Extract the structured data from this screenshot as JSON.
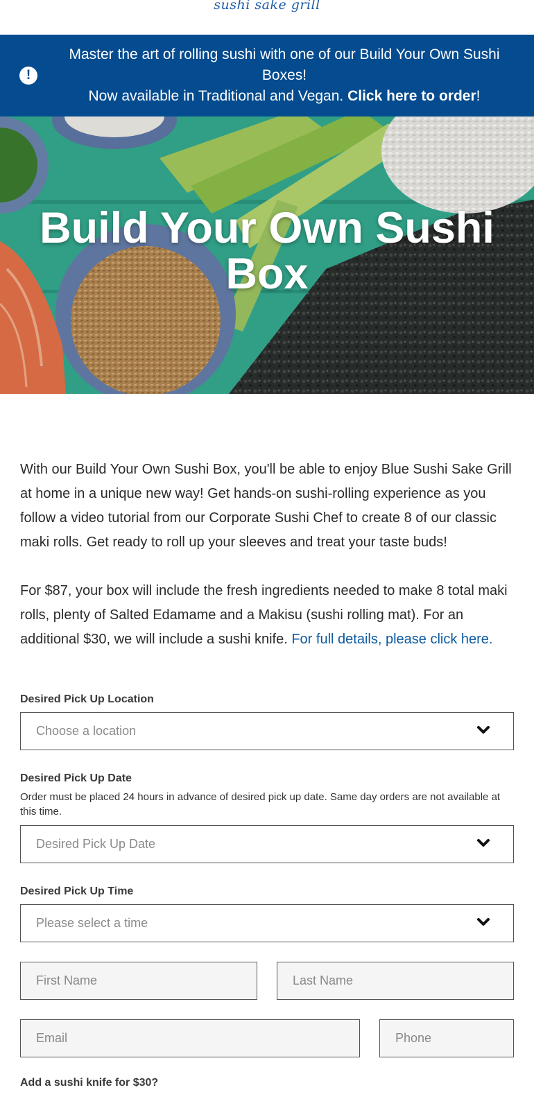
{
  "logo": {
    "text": "sushi sake grill"
  },
  "banner": {
    "icon": "exclamation-circle-icon",
    "line1": "Master the art of rolling sushi with one of our Build Your Own Sushi Boxes!",
    "line2_prefix": "Now available in Traditional and Vegan. ",
    "cta": "Click here to order",
    "line2_suffix": "!"
  },
  "hero": {
    "title": "Build Your Own Sushi Box"
  },
  "content": {
    "para1": "With our Build Your Own Sushi Box, you'll be able to enjoy Blue Sushi Sake Grill at home in a unique new way! Get hands-on sushi-rolling experience as you follow a video tutorial from our Corporate Sushi Chef to create 8 of our classic maki rolls. Get ready to roll up your sleeves and treat your taste buds!",
    "para2": "For $87, your box will include the fresh ingredients needed to make 8 total maki rolls, plenty of Salted Edamame and a Makisu (sushi rolling mat). For an additional $30, we will include a sushi knife. ",
    "details_link": "For full details, please click here."
  },
  "form": {
    "location_label": "Desired Pick Up Location",
    "location_value": "Choose a location",
    "date_label": "Desired Pick Up Date",
    "date_help": "Order must be placed 24 hours in advance of desired pick up date. Same day orders are not available at this time.",
    "date_value": "Desired Pick Up Date",
    "time_label": "Desired Pick Up Time",
    "time_value": "Please select a time",
    "first_name_placeholder": "First Name",
    "last_name_placeholder": "Last Name",
    "email_placeholder": "Email",
    "phone_placeholder": "Phone",
    "knife_label": "Add a sushi knife for $30?"
  },
  "colors": {
    "brand_blue": "#044b8f",
    "link_blue": "#0d5aa1"
  }
}
